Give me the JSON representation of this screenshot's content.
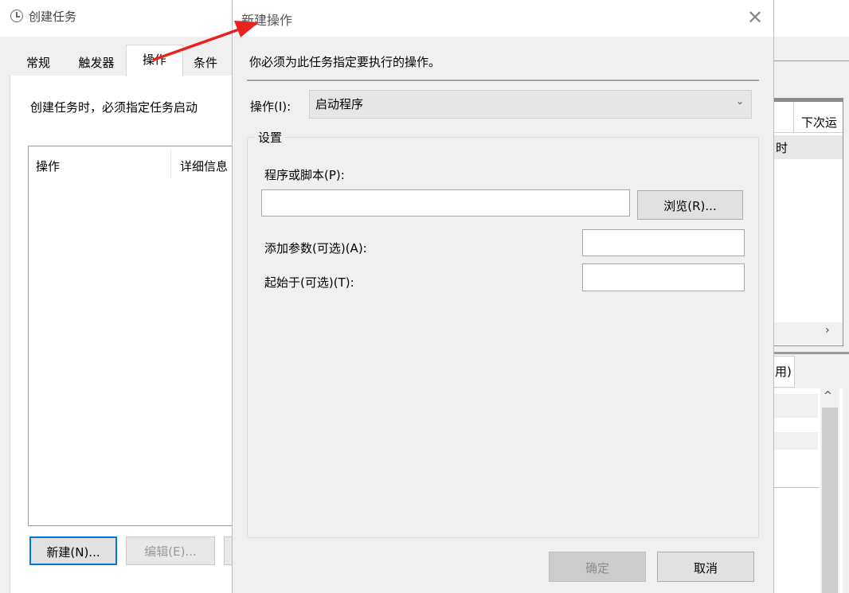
{
  "background_window": {
    "title": "创建任务",
    "tabs": [
      "常规",
      "触发器",
      "操作",
      "条件"
    ],
    "active_tab": "操作",
    "description": "创建任务时，必须指定任务启动",
    "list_headers": [
      "操作",
      "详细信息"
    ],
    "buttons": {
      "new": "新建(N)...",
      "edit": "编辑(E)..."
    }
  },
  "right_window": {
    "col_header": "下次运",
    "row_text": "时",
    "tab_fragment": "用)",
    "scroll_right": "›",
    "scroll_up": "^"
  },
  "dialog": {
    "title": "新建操作",
    "close": "✕",
    "instruction": "你必须为此任务指定要执行的操作。",
    "action_label": "操作(I):",
    "action_value": "启动程序",
    "action_chevron": "⌄",
    "settings_group": "设置",
    "program_label": "程序或脚本(P):",
    "program_value": "",
    "browse": "浏览(R)...",
    "args_label": "添加参数(可选)(A):",
    "args_value": "",
    "start_in_label": "起始于(可选)(T):",
    "start_in_value": "",
    "ok": "确定",
    "cancel": "取消"
  },
  "colors": {
    "focus_border": "#0078d7",
    "annotation_arrow": "#e8231f"
  }
}
